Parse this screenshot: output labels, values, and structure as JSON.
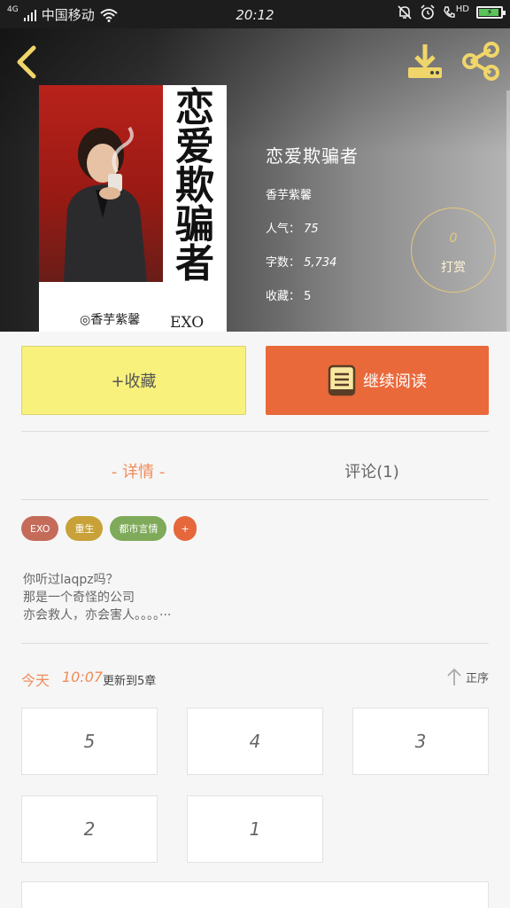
{
  "status_bar": {
    "network_type": "4G",
    "carrier": "中国移动",
    "time": "20:12",
    "hd_label": "HD",
    "icons": [
      "signal-icon",
      "wifi-icon",
      "bell-off-icon",
      "alarm-icon",
      "call-hd-icon",
      "battery-icon"
    ],
    "battery_charging": true
  },
  "header": {
    "back_icon": "back-chevron-icon",
    "download_icon": "download-icon",
    "share_icon": "share-icon",
    "accent_color": "#f0d66a"
  },
  "cover": {
    "title_chars": [
      "恋",
      "爱",
      "欺",
      "骗",
      "者"
    ],
    "author_line": "◎香芋紫馨",
    "brand": "EXO"
  },
  "book": {
    "title": "恋爱欺骗者",
    "author": "香芋紫馨",
    "popularity_label": "人气：",
    "popularity": "75",
    "word_count_label": "字数：",
    "word_count": "5,734",
    "favorites_label": "收藏：",
    "favorites": "5"
  },
  "tip": {
    "count": "0",
    "label": "打赏"
  },
  "actions": {
    "collect_label": "+收藏",
    "read_label": "继续阅读",
    "collect_color": "#f8f17c",
    "read_color": "#e9693b"
  },
  "tabs": {
    "details": "- 详情 -",
    "comments": "评论(1)"
  },
  "tags": [
    {
      "label": "EXO",
      "color": "#c46b5a"
    },
    {
      "label": "重生",
      "color": "#c8a238"
    },
    {
      "label": "都市言情",
      "color": "#7eaa5a"
    },
    {
      "label": "+",
      "color": "#e6673c"
    }
  ],
  "intro": [
    "你听过laqpz吗？",
    "那是一个奇怪的公司",
    "亦会救人，亦会害人。。。。···"
  ],
  "update": {
    "day": "今天",
    "time": "10:07",
    "info": "更新到5章",
    "sort_label": "正序"
  },
  "chapters": [
    "5",
    "4",
    "3",
    "2",
    "1"
  ]
}
